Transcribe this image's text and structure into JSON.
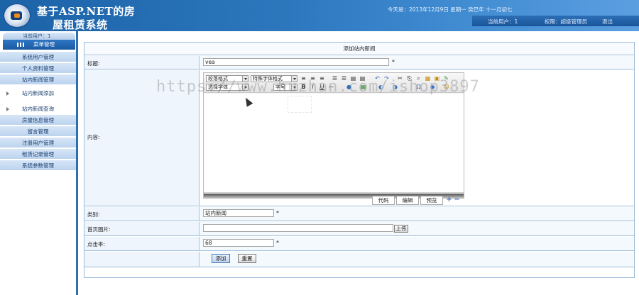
{
  "header": {
    "title_line1": "基于ASP.NET的房",
    "title_line2": "屋租赁系统",
    "date_text": "今天是：2013年12月9日 星期一  癸巳年 十一月初七",
    "current_user_label": "当前用户：1",
    "role_label": "权限：超级管理员",
    "logout_label": "退出"
  },
  "sidebar": {
    "user_info": "当前用户：1",
    "menu_title": "菜单管理",
    "items": [
      {
        "label": "系统用户管理"
      },
      {
        "label": "个人资料管理"
      },
      {
        "label": "站内新闻管理"
      },
      {
        "label": "站内新闻添加"
      },
      {
        "label": "站内新闻查询"
      },
      {
        "label": "房屋信息管理"
      },
      {
        "label": "留言管理"
      },
      {
        "label": "注册用户管理"
      },
      {
        "label": "租赁记录管理"
      },
      {
        "label": "系统参数管理"
      }
    ]
  },
  "form": {
    "title": "添加站内新闻",
    "title_label": "标题:",
    "title_value": "vea",
    "content_label": "内容:",
    "category_label": "类别:",
    "category_value": "站内新闻",
    "image_label": "首页图片:",
    "upload_label": "上传",
    "clicks_label": "点击率:",
    "clicks_value": "68",
    "required_mark": "*",
    "submit_label": "添加",
    "reset_label": "重置"
  },
  "editor": {
    "paragraph_select": "段落格式",
    "fontface_select": "特殊字体格式",
    "font_select": "选择字体",
    "size_select": "字号",
    "mode_tabs": [
      "代码",
      "编辑",
      "预览"
    ],
    "icons": [
      "align-left-icon",
      "align-center-icon",
      "align-right-icon",
      "ordered-list-icon",
      "unordered-list-icon",
      "outdent-icon",
      "indent-icon",
      "undo-icon",
      "redo-icon",
      "cut-icon",
      "copy-icon",
      "find-icon",
      "paste-icon",
      "paste-word-icon",
      "insert-image-icon",
      "bold-icon",
      "italic-icon",
      "underline-icon"
    ]
  },
  "watermark": "https://www.huzhan.com/ishop3897"
}
